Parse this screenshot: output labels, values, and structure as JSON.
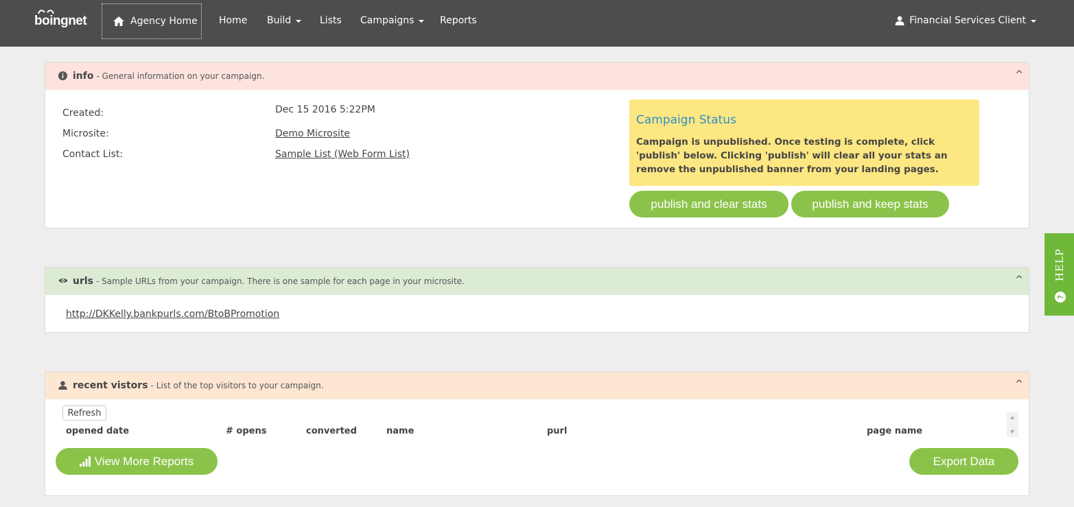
{
  "brand": {
    "logo_text": "boingnet"
  },
  "nav": {
    "agency_home": "Agency Home",
    "items": [
      {
        "label": "Home",
        "dropdown": false
      },
      {
        "label": "Build",
        "dropdown": true
      },
      {
        "label": "Lists",
        "dropdown": false
      },
      {
        "label": "Campaigns",
        "dropdown": true
      },
      {
        "label": "Reports",
        "dropdown": false
      }
    ],
    "user_menu": "Financial Services Client"
  },
  "info_panel": {
    "title": "info",
    "subtitle": "- General information on your campaign.",
    "toggle": "^",
    "bg_color": "#fde3de",
    "fields": [
      {
        "label": "Created:",
        "value": "Dec 15 2016 5:22PM",
        "link": false
      },
      {
        "label": "Microsite:",
        "value": "Demo Microsite",
        "link": true
      },
      {
        "label": "Contact List:",
        "value": "Sample List (Web Form List)",
        "link": true
      }
    ],
    "status": {
      "title": "Campaign Status",
      "message": "Campaign is unpublished. Once testing is complete, click 'publish' below. Clicking 'publish' will clear all your stats an remove the unpublished banner from your landing pages."
    },
    "buttons": {
      "publish_clear": "publish and clear stats",
      "publish_keep": "publish and keep stats"
    }
  },
  "urls_panel": {
    "title": "urls",
    "subtitle": "- Sample URLs from your campaign. There is one sample for each page in your microsite.",
    "toggle": "^",
    "bg_color": "#dcebd4",
    "url": "http://DKKelly.bankpurls.com/BtoBPromotion"
  },
  "visitors_panel": {
    "title": "recent vistors",
    "subtitle": "- List of the top visitors to your campaign.",
    "toggle": "^",
    "bg_color": "#fde6d2",
    "refresh": "Refresh",
    "columns": [
      "opened date",
      "# opens",
      "converted",
      "name",
      "purl",
      "page name"
    ],
    "rows": [],
    "view_more": "View More Reports",
    "export": "Export Data"
  },
  "help_tab": {
    "label": "HELP"
  },
  "colors": {
    "navbar": "#4d4d4d",
    "accent_green": "#8bc34a",
    "status_yellow": "#fde782",
    "link_blue": "#2e8fc9"
  }
}
